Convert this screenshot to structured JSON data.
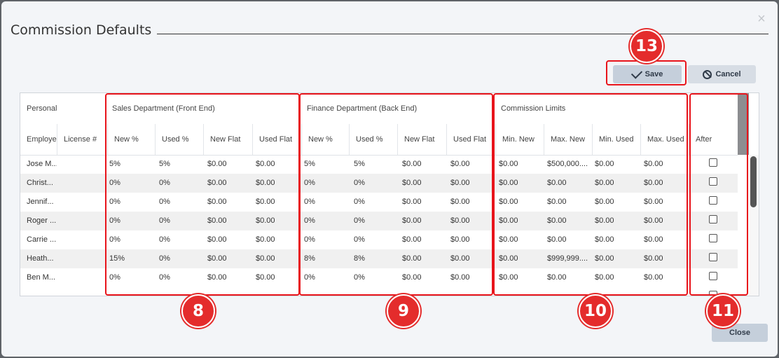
{
  "dialog": {
    "title": "Commission Defaults",
    "close_icon": "×",
    "save_label": "Save",
    "cancel_label": "Cancel",
    "close_label": "Close"
  },
  "grid": {
    "groups": {
      "personal": "Personal",
      "sales": "Sales Department (Front End)",
      "finance": "Finance Department (Back End)",
      "limits": "Commission Limits"
    },
    "columns": [
      "Employe",
      "License #",
      "New %",
      "Used %",
      "New Flat",
      "Used Flat",
      "New %",
      "Used %",
      "New Flat",
      "Used Flat",
      "Min. New",
      "Max. New",
      "Min. Used",
      "Max. Used",
      "After"
    ],
    "rows": [
      {
        "cells": [
          "Jose M...",
          "",
          "5%",
          "5%",
          "$0.00",
          "$0.00",
          "5%",
          "5%",
          "$0.00",
          "$0.00",
          "$0.00",
          "$500,000....",
          "$0.00",
          "$0.00"
        ],
        "after": false
      },
      {
        "cells": [
          "Christ...",
          "",
          "0%",
          "0%",
          "$0.00",
          "$0.00",
          "0%",
          "0%",
          "$0.00",
          "$0.00",
          "$0.00",
          "$0.00",
          "$0.00",
          "$0.00"
        ],
        "after": false
      },
      {
        "cells": [
          "Jennif...",
          "",
          "0%",
          "0%",
          "$0.00",
          "$0.00",
          "0%",
          "0%",
          "$0.00",
          "$0.00",
          "$0.00",
          "$0.00",
          "$0.00",
          "$0.00"
        ],
        "after": false
      },
      {
        "cells": [
          "Roger ...",
          "",
          "0%",
          "0%",
          "$0.00",
          "$0.00",
          "0%",
          "0%",
          "$0.00",
          "$0.00",
          "$0.00",
          "$0.00",
          "$0.00",
          "$0.00"
        ],
        "after": false
      },
      {
        "cells": [
          "Carrie ...",
          "",
          "0%",
          "0%",
          "$0.00",
          "$0.00",
          "0%",
          "0%",
          "$0.00",
          "$0.00",
          "$0.00",
          "$0.00",
          "$0.00",
          "$0.00"
        ],
        "after": false
      },
      {
        "cells": [
          "Heath...",
          "",
          "15%",
          "0%",
          "$0.00",
          "$0.00",
          "8%",
          "8%",
          "$0.00",
          "$0.00",
          "$0.00",
          "$999,999....",
          "$0.00",
          "$0.00"
        ],
        "after": false
      },
      {
        "cells": [
          "Ben M...",
          "",
          "0%",
          "0%",
          "$0.00",
          "$0.00",
          "0%",
          "0%",
          "$0.00",
          "$0.00",
          "$0.00",
          "$0.00",
          "$0.00",
          "$0.00"
        ],
        "after": false
      }
    ]
  },
  "callouts": {
    "sales": "8",
    "finance": "9",
    "limits": "10",
    "after": "11",
    "save": "13"
  },
  "colors": {
    "callout": "#e42c2c",
    "highlight_border": "#e8141b",
    "button": "#c5cfdb"
  },
  "icons": [
    "close-icon",
    "checkmark-icon",
    "ban-icon"
  ]
}
